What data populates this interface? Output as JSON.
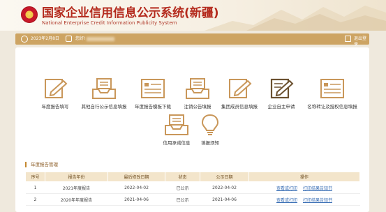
{
  "header": {
    "title_cn": "国家企业信用信息公示系统(新疆)",
    "title_en": "National Enterprise Credit Information Publicity System",
    "emblem_icon": "national-emblem-icon"
  },
  "topbar": {
    "date": "2023年2月8日",
    "greeting": "您好!",
    "logout": "退出登录"
  },
  "tiles": [
    {
      "label": "年度报告填写",
      "icon": "pen-edit-icon"
    },
    {
      "label": "其他自行公示信息填报",
      "icon": "inbox-tray-icon"
    },
    {
      "label": "年度报告模板下载",
      "icon": "template-form-icon"
    },
    {
      "label": "注销公告填报",
      "icon": "inbox-tray-icon"
    },
    {
      "label": "集团成员信息填报",
      "icon": "pen-edit-icon"
    },
    {
      "label": "企业自主申请",
      "icon": "pen-edit-dark-icon"
    },
    {
      "label": "名称转让及授权信息填报",
      "icon": "template-form-icon"
    },
    {
      "label": "信用承诺信息",
      "icon": "inbox-tray-icon"
    },
    {
      "label": "填报须知",
      "icon": "lightbulb-icon"
    }
  ],
  "section": {
    "title": "年度报告管理"
  },
  "table": {
    "headers": [
      "序号",
      "报告年份",
      "最后修改日期",
      "状态",
      "公示日期",
      "操作"
    ],
    "rows": [
      {
        "no": "1",
        "year": "2021年度报告",
        "modified": "2022-04-02",
        "status": "已公示",
        "pubdate": "2022-04-02",
        "action1": "查看或打印",
        "action2": "打印结果告知书"
      },
      {
        "no": "2",
        "year": "2020年年度报告",
        "modified": "2021-04-06",
        "status": "已公示",
        "pubdate": "2021-04-06",
        "action1": "查看或打印",
        "action2": "打印结果告知书"
      }
    ]
  },
  "colors": {
    "accent": "#cda463",
    "title_red": "#b42a1d",
    "icon_gold": "#c9975a",
    "link_blue": "#3a6fb5"
  }
}
